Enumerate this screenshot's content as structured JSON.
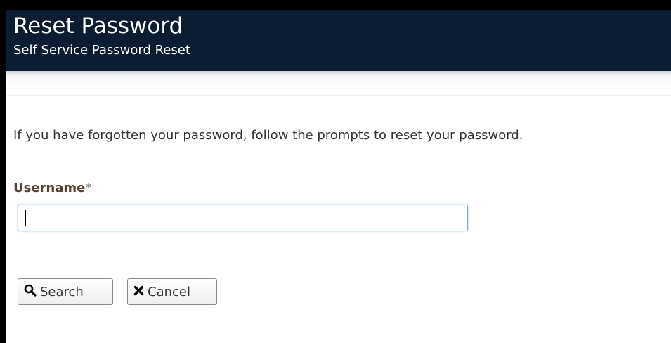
{
  "header": {
    "title": "Reset Password",
    "subtitle": "Self Service Password Reset"
  },
  "main": {
    "intro": "If you have forgotten your password, follow the prompts to reset your password.",
    "username": {
      "label": "Username",
      "required_mark": "*",
      "value": "",
      "placeholder": ""
    },
    "buttons": {
      "search": {
        "label": "Search",
        "icon": "search-icon"
      },
      "cancel": {
        "label": "Cancel",
        "icon": "close-icon"
      }
    }
  },
  "colors": {
    "header_bg": "#0b1c33",
    "label": "#5a3f32",
    "input_focus_border": "#7aa7d8"
  }
}
